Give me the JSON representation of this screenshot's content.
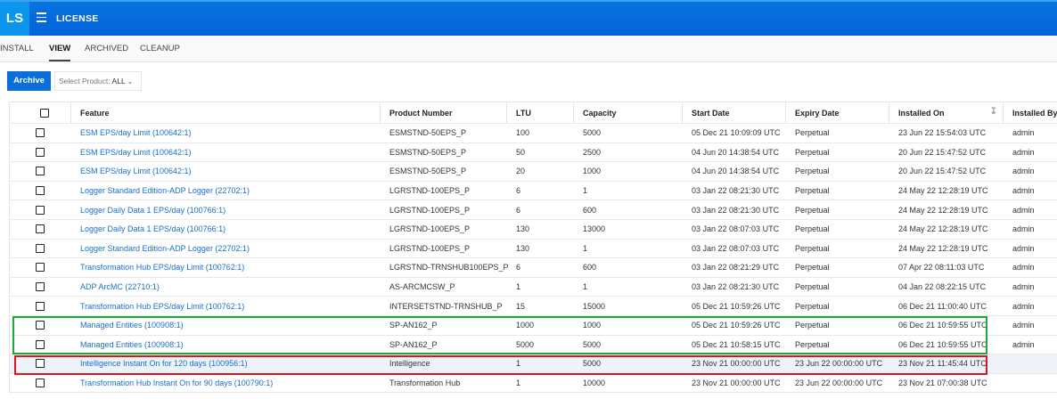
{
  "app": {
    "logo": "LS",
    "title": "LICENSE"
  },
  "tabs": [
    {
      "label": "INSTALL",
      "active": false
    },
    {
      "label": "VIEW",
      "active": true
    },
    {
      "label": "ARCHIVED",
      "active": false
    },
    {
      "label": "CLEANUP",
      "active": false
    }
  ],
  "toolbar": {
    "archive_label": "Archive",
    "select_label": "Select Product:",
    "select_value": "ALL"
  },
  "colors": {
    "header": "#0064d6",
    "accent": "#0a6fd8",
    "link": "#1a6fc8",
    "green_box": "#1fa83a",
    "red_box": "#e0141e"
  },
  "table": {
    "columns": [
      "Feature",
      "Product Number",
      "LTU",
      "Capacity",
      "Start Date",
      "Expiry Date",
      "Installed On",
      "Installed By"
    ],
    "sorted_column": "Installed On",
    "rows": [
      [
        "ESM EPS/day Limit (100642:1)",
        "ESMSTND-50EPS_P",
        "100",
        "5000",
        "05 Dec 21 10:09:09 UTC",
        "Perpetual",
        "23 Jun 22 15:54:03 UTC",
        "admin"
      ],
      [
        "ESM EPS/day Limit (100642:1)",
        "ESMSTND-50EPS_P",
        "50",
        "2500",
        "04 Jun 20 14:38:54 UTC",
        "Perpetual",
        "20 Jun 22 15:47:52 UTC",
        "admin"
      ],
      [
        "ESM EPS/day Limit (100642:1)",
        "ESMSTND-50EPS_P",
        "20",
        "1000",
        "04 Jun 20 14:38:54 UTC",
        "Perpetual",
        "20 Jun 22 15:47:52 UTC",
        "admin"
      ],
      [
        "Logger Standard Edition-ADP Logger (22702:1)",
        "LGRSTND-100EPS_P",
        "6",
        "1",
        "03 Jan 22 08:21:30 UTC",
        "Perpetual",
        "24 May 22 12:28:19 UTC",
        "admin"
      ],
      [
        "Logger Daily Data 1 EPS/day (100766:1)",
        "LGRSTND-100EPS_P",
        "6",
        "600",
        "03 Jan 22 08:21:30 UTC",
        "Perpetual",
        "24 May 22 12:28:19 UTC",
        "admin"
      ],
      [
        "Logger Daily Data 1 EPS/day (100766:1)",
        "LGRSTND-100EPS_P",
        "130",
        "13000",
        "03 Jan 22 08:07:03 UTC",
        "Perpetual",
        "24 May 22 12:28:19 UTC",
        "admin"
      ],
      [
        "Logger Standard Edition-ADP Logger (22702:1)",
        "LGRSTND-100EPS_P",
        "130",
        "1",
        "03 Jan 22 08:07:03 UTC",
        "Perpetual",
        "24 May 22 12:28:19 UTC",
        "admin"
      ],
      [
        "Transformation Hub EPS/day Limit (100762:1)",
        "LGRSTND-TRNSHUB100EPS_P",
        "6",
        "600",
        "03 Jan 22 08:21:29 UTC",
        "Perpetual",
        "07 Apr 22 08:11:03 UTC",
        "admin"
      ],
      [
        "ADP ArcMC (22710:1)",
        "AS-ARCMCSW_P",
        "1",
        "1",
        "03 Jan 22 08:21:30 UTC",
        "Perpetual",
        "04 Jan 22 08:22:15 UTC",
        "admin"
      ],
      [
        "Transformation Hub EPS/day Limit (100762:1)",
        "INTERSETSTND-TRNSHUB_P",
        "15",
        "15000",
        "05 Dec 21 10:59:26 UTC",
        "Perpetual",
        "06 Dec 21 11:00:40 UTC",
        "admin"
      ],
      [
        "Managed Entities (100908:1)",
        "SP-AN162_P",
        "1000",
        "1000",
        "05 Dec 21 10:59:26 UTC",
        "Perpetual",
        "06 Dec 21 10:59:55 UTC",
        "admin"
      ],
      [
        "Managed Entities (100908:1)",
        "SP-AN162_P",
        "5000",
        "5000",
        "05 Dec 21 10:58:15 UTC",
        "Perpetual",
        "06 Dec 21 10:59:55 UTC",
        "admin"
      ],
      [
        "Intelligence Instant On for 120 days (100956:1)",
        "Intelligence",
        "1",
        "5000",
        "23 Nov 21 00:00:00 UTC",
        "23 Jun 22 00:00:00 UTC",
        "23 Nov 21 11:45:44 UTC",
        ""
      ],
      [
        "Transformation Hub Instant On for 90 days (100790:1)",
        "Transformation Hub",
        "1",
        "10000",
        "23 Nov 21 00:00:00 UTC",
        "23 Jun 22 00:00:00 UTC",
        "23 Nov 21 07:00:38 UTC",
        ""
      ]
    ],
    "hovered_row": 12
  }
}
